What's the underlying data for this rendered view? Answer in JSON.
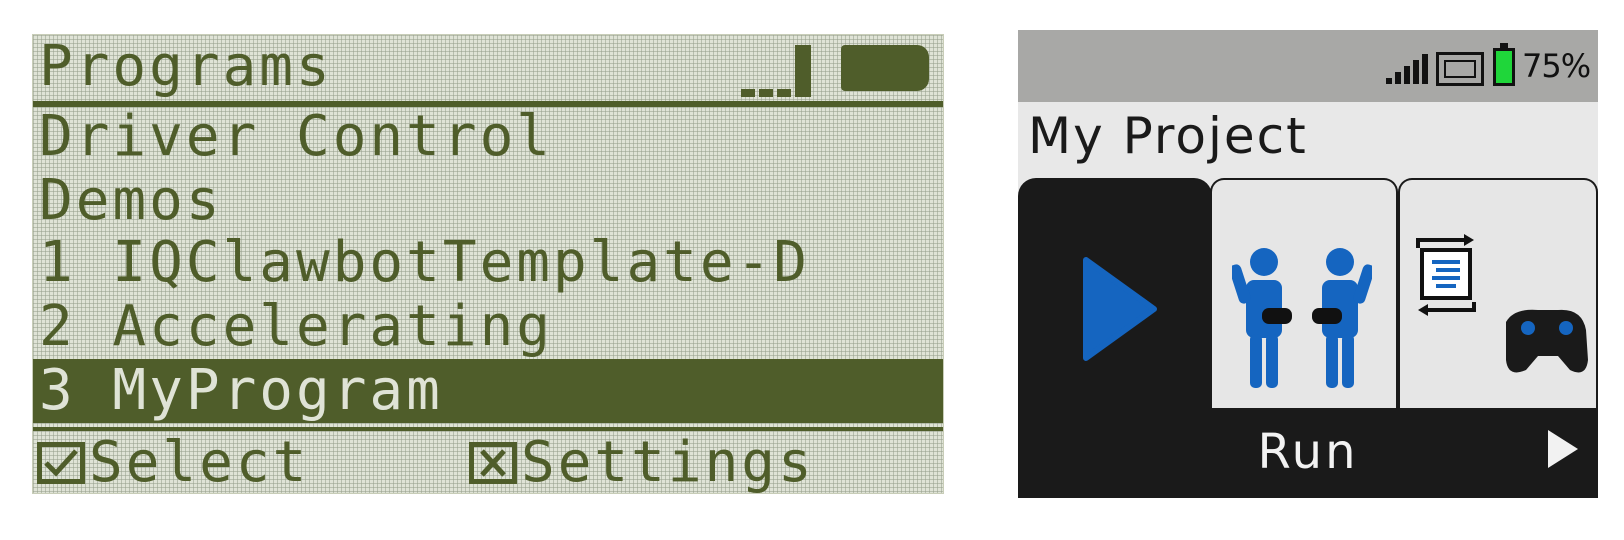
{
  "lcd": {
    "title": "Programs",
    "rows": [
      "Driver Control",
      "Demos",
      "1 IQClawbotTemplate-D",
      "2 Accelerating",
      "3 MyProgram"
    ],
    "selected_index": 4,
    "footer": {
      "select_icon": "checkbox-icon",
      "select_label": "Select",
      "settings_icon": "x-box-icon",
      "settings_label": "Settings"
    },
    "colors": {
      "ink": "#4f5d2a",
      "background": "#dfe3d6"
    }
  },
  "brain": {
    "status": {
      "signal_icon": "signal-bars-icon",
      "screen_icon": "screen-icon",
      "battery_icon": "battery-icon",
      "battery_percent": "75%",
      "battery_color": "#1fd63a"
    },
    "project_name": "My Project",
    "tabs": [
      {
        "name": "run",
        "icon": "play-icon",
        "selected": true
      },
      {
        "name": "drive",
        "icon": "drivers-icon",
        "selected": false
      },
      {
        "name": "configure",
        "icon": "code-controller-icon",
        "selected": false
      }
    ],
    "action_label": "Run",
    "next_icon": "next-arrow-icon",
    "accent_color": "#1565c0"
  }
}
